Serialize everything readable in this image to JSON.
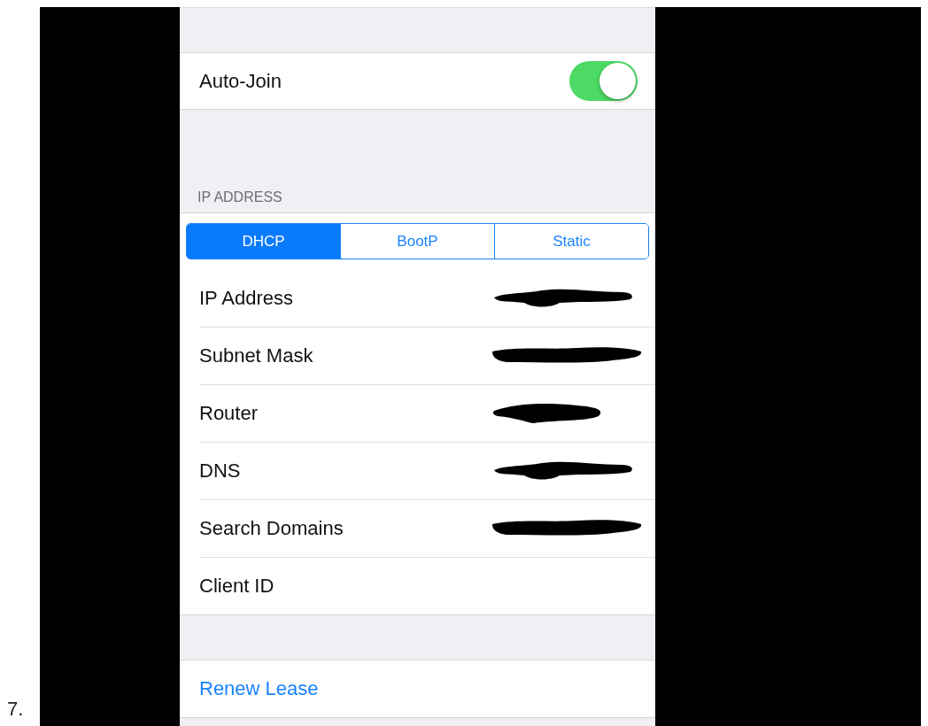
{
  "list_number": "7.",
  "auto_join": {
    "label": "Auto-Join",
    "on": true
  },
  "ip_section": {
    "header": "IP ADDRESS",
    "modes": [
      {
        "label": "DHCP",
        "selected": true
      },
      {
        "label": "BootP",
        "selected": false
      },
      {
        "label": "Static",
        "selected": false
      }
    ],
    "rows": [
      {
        "label": "IP Address",
        "redacted": true
      },
      {
        "label": "Subnet Mask",
        "redacted": true
      },
      {
        "label": "Router",
        "redacted": true
      },
      {
        "label": "DNS",
        "redacted": true
      },
      {
        "label": "Search Domains",
        "redacted": true
      },
      {
        "label": "Client ID",
        "redacted": false
      }
    ]
  },
  "renew_lease": {
    "label": "Renew Lease"
  }
}
